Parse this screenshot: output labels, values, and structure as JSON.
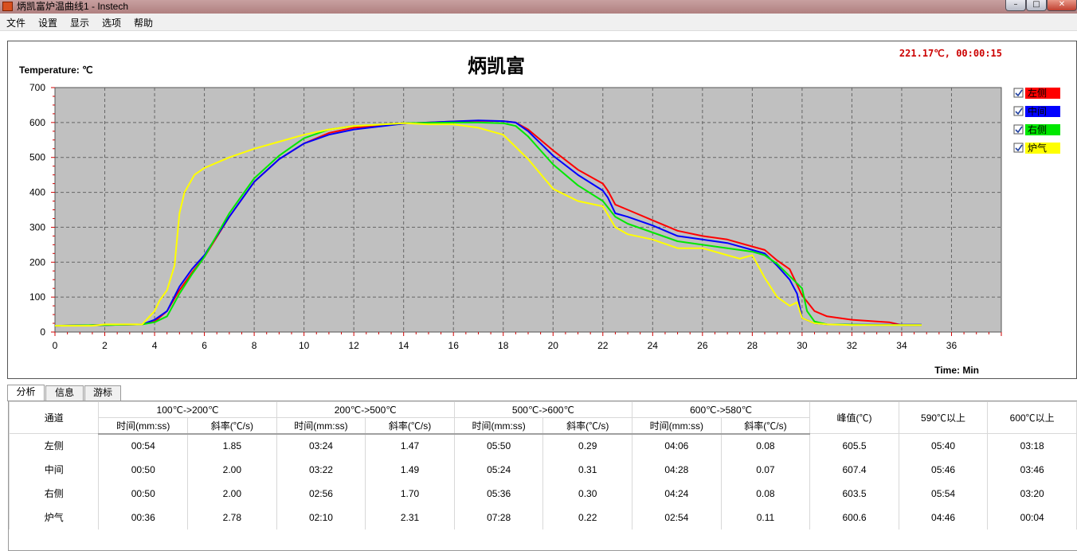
{
  "window": {
    "title": "炳凯富炉温曲线1 - Instech"
  },
  "menu": [
    "文件",
    "设置",
    "显示",
    "选项",
    "帮助"
  ],
  "chart": {
    "status": "221.17℃, 00:00:15",
    "status_color": "#cc0000",
    "plot_bg": "#c0c0c0"
  },
  "chart_data": {
    "type": "line",
    "title": "炳凯富",
    "ylabel": "Temperature: ℃",
    "xlabel": "Time: Min",
    "xlim": [
      0,
      38
    ],
    "ylim": [
      0,
      700
    ],
    "xticks": [
      0,
      2,
      4,
      6,
      8,
      10,
      12,
      14,
      16,
      18,
      20,
      22,
      24,
      26,
      28,
      30,
      32,
      34,
      36
    ],
    "yticks": [
      0,
      100,
      200,
      300,
      400,
      500,
      600,
      700
    ],
    "grid": true,
    "legend_position": "right",
    "series": [
      {
        "name": "左侧",
        "color": "#ff0000",
        "x": [
          0,
          2,
          3.5,
          4,
          4.5,
          5,
          5.5,
          6,
          7,
          8,
          9,
          10,
          11,
          12,
          14,
          16,
          17,
          18,
          18.5,
          19,
          20,
          21,
          22,
          22.2,
          22.5,
          23,
          24,
          25,
          26,
          27,
          28,
          28.5,
          29,
          29.5,
          30,
          30.5,
          31,
          32,
          33,
          33.5,
          34,
          34.8
        ],
        "y": [
          18,
          20,
          22,
          30,
          60,
          120,
          170,
          215,
          330,
          430,
          495,
          540,
          570,
          585,
          597,
          603,
          605,
          604,
          600,
          580,
          520,
          465,
          425,
          405,
          365,
          350,
          320,
          290,
          275,
          265,
          245,
          235,
          205,
          180,
          105,
          60,
          45,
          35,
          30,
          28,
          20,
          20
        ]
      },
      {
        "name": "中间",
        "color": "#0000ff",
        "x": [
          0,
          2,
          3.5,
          4,
          4.5,
          5,
          5.5,
          6,
          7,
          8,
          9,
          10,
          11,
          12,
          14,
          16,
          17,
          18,
          18.5,
          19,
          20,
          21,
          22,
          22.2,
          22.5,
          23,
          24,
          25,
          26,
          27,
          28,
          28.5,
          29,
          29.5,
          29.8,
          30,
          30.5,
          31,
          32,
          33,
          34,
          34.8
        ],
        "y": [
          18,
          20,
          22,
          35,
          60,
          130,
          180,
          220,
          330,
          430,
          495,
          540,
          565,
          580,
          597,
          603,
          606,
          604,
          600,
          575,
          505,
          450,
          405,
          385,
          340,
          330,
          305,
          275,
          265,
          255,
          235,
          225,
          190,
          150,
          110,
          40,
          25,
          22,
          21,
          21,
          21,
          21
        ]
      },
      {
        "name": "右侧",
        "color": "#00e800",
        "x": [
          0,
          2,
          3.5,
          4,
          4.5,
          5,
          5.5,
          6,
          7,
          8,
          9,
          10,
          11,
          12,
          14,
          16,
          17,
          18,
          18.5,
          19,
          20,
          21,
          22,
          22.5,
          23,
          24,
          25,
          26,
          27,
          28,
          28.5,
          29,
          29.5,
          30,
          30.2,
          30.5,
          31,
          32,
          33,
          34,
          34.8
        ],
        "y": [
          18,
          20,
          22,
          28,
          45,
          110,
          165,
          215,
          340,
          440,
          505,
          555,
          580,
          590,
          598,
          600,
          600,
          598,
          590,
          560,
          480,
          420,
          375,
          330,
          310,
          285,
          260,
          250,
          240,
          230,
          220,
          195,
          160,
          125,
          60,
          30,
          22,
          21,
          20,
          20,
          20
        ]
      },
      {
        "name": "炉气",
        "color": "#ffff00",
        "x": [
          0,
          1.5,
          2,
          3.5,
          4,
          4.2,
          4.5,
          4.8,
          5,
          5.2,
          5.6,
          6,
          7,
          8,
          9,
          10,
          11,
          12,
          14,
          15,
          16,
          17,
          18,
          19,
          20,
          21,
          22,
          22.5,
          23,
          24,
          25,
          26,
          27,
          27.5,
          28,
          28.5,
          29,
          29.5,
          29.8,
          30,
          30.5,
          31,
          32,
          33,
          34,
          34.8
        ],
        "y": [
          18,
          18,
          22,
          22,
          60,
          90,
          120,
          190,
          340,
          400,
          450,
          470,
          500,
          525,
          545,
          565,
          580,
          590,
          598,
          595,
          595,
          585,
          565,
          495,
          410,
          375,
          360,
          300,
          280,
          265,
          240,
          240,
          220,
          210,
          220,
          155,
          100,
          75,
          85,
          40,
          25,
          22,
          20,
          20,
          20,
          20
        ]
      }
    ]
  },
  "tabs": [
    "分析",
    "信息",
    "游标"
  ],
  "table": {
    "channel_header": "通道",
    "groups": [
      "100℃->200℃",
      "200℃->500℃",
      "500℃->600℃",
      "600℃->580℃"
    ],
    "sub_time": "时间(mm:ss)",
    "sub_slope": "斜率(℃/s)",
    "peak_header": "峰值(℃)",
    "above590_header": "590℃以上",
    "above600_header": "600℃以上",
    "rows": [
      [
        "左侧",
        "00:54",
        "1.85",
        "03:24",
        "1.47",
        "05:50",
        "0.29",
        "04:06",
        "0.08",
        "605.5",
        "05:40",
        "03:18"
      ],
      [
        "中间",
        "00:50",
        "2.00",
        "03:22",
        "1.49",
        "05:24",
        "0.31",
        "04:28",
        "0.07",
        "607.4",
        "05:46",
        "03:46"
      ],
      [
        "右侧",
        "00:50",
        "2.00",
        "02:56",
        "1.70",
        "05:36",
        "0.30",
        "04:24",
        "0.08",
        "603.5",
        "05:54",
        "03:20"
      ],
      [
        "炉气",
        "00:36",
        "2.78",
        "02:10",
        "2.31",
        "07:28",
        "0.22",
        "02:54",
        "0.11",
        "600.6",
        "04:46",
        "00:04"
      ]
    ]
  }
}
